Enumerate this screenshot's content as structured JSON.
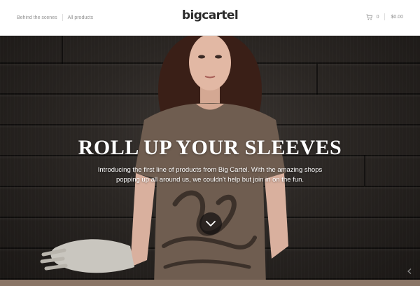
{
  "header": {
    "nav_left": [
      "Behind the scenes",
      "All products"
    ],
    "logo": "bigcartel",
    "cart_count": "0",
    "cart_total": "$0.00"
  },
  "hero": {
    "title": "ROLL UP YOUR SLEEVES",
    "text": "Introducing the first line of products from Big Cartel. With the amazing shops popping up all around us, we couldn't help but join in on the fun.",
    "scroll_icon": "chevron-down-icon"
  },
  "colors": {
    "header_bg": "#ffffff",
    "nav_text": "#8f8f8f",
    "logo_text": "#2a2a2a",
    "hero_bg": "#2a2623",
    "hero_text": "#ffffff",
    "shirt": "#6f5d50",
    "band": "#8a7566"
  }
}
